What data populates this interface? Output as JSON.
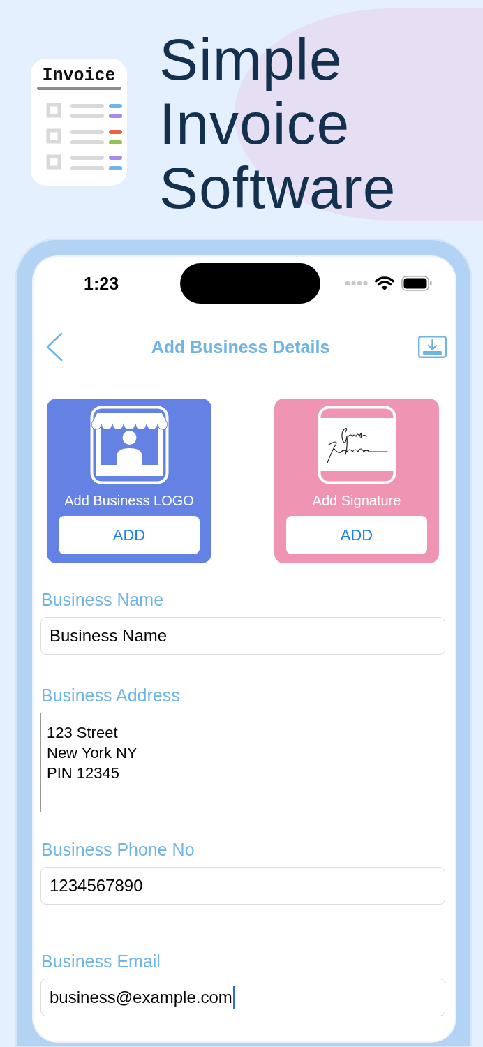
{
  "app_icon": {
    "title": "Invoice"
  },
  "headline": [
    "Simple",
    "Invoice",
    "Software"
  ],
  "phone": {
    "status_bar": {
      "time": "1:23"
    },
    "nav": {
      "title": "Add Business Details"
    },
    "upload_cards": [
      {
        "kind": "logo",
        "label": "Add Business LOGO",
        "button": "ADD",
        "color": "#6382e3"
      },
      {
        "kind": "signature",
        "label": "Add Signature",
        "button": "ADD",
        "color": "#ef95b3"
      }
    ],
    "fields": [
      {
        "kind": "single",
        "label": "Business Name",
        "value": "Business Name",
        "focused": false
      },
      {
        "kind": "multi",
        "label": "Business Address",
        "value": "123 Street\nNew York NY\nPIN 12345",
        "focused": false
      },
      {
        "kind": "single",
        "label": "Business Phone No",
        "value": "1234567890",
        "focused": false
      },
      {
        "kind": "single",
        "label": "Business Email",
        "value": "business@example.com",
        "focused": true
      }
    ]
  }
}
